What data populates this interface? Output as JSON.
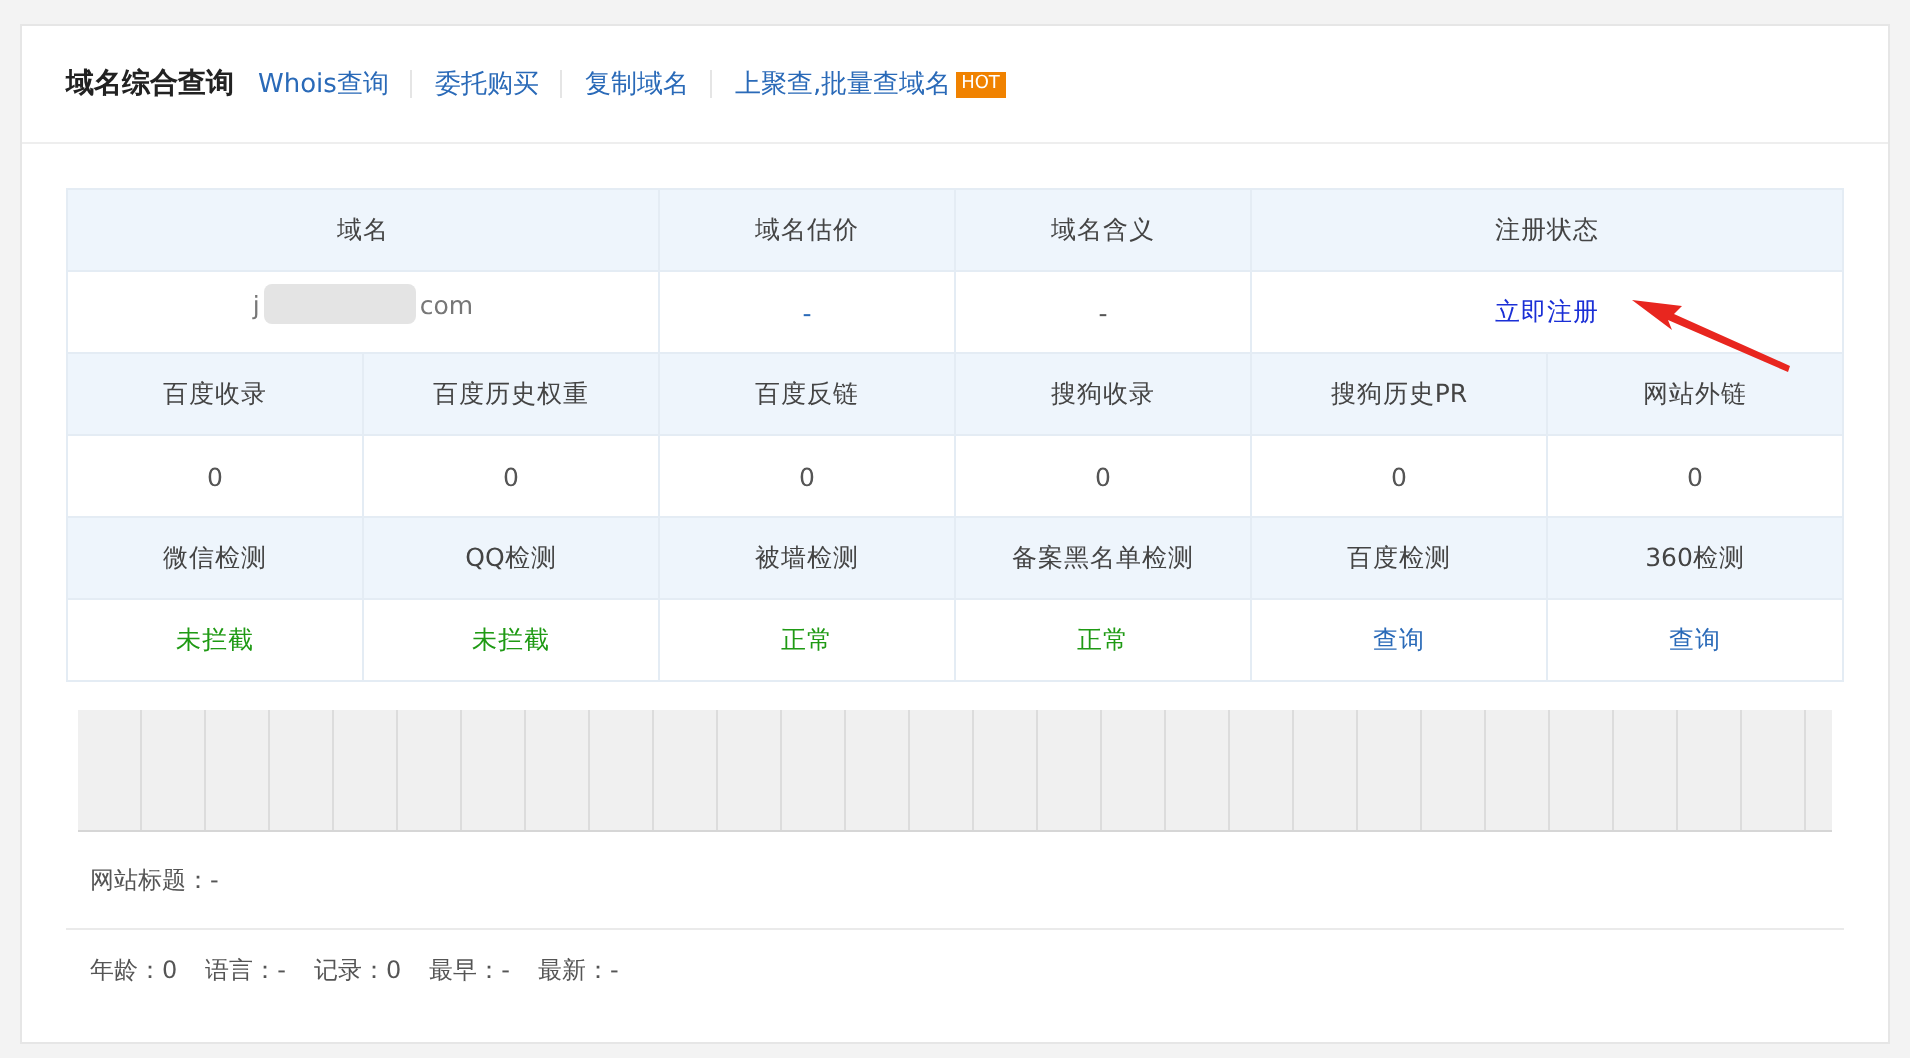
{
  "header": {
    "title": "域名综合查询",
    "links": [
      {
        "label": "Whois查询"
      },
      {
        "label": "委托购买"
      },
      {
        "label": "复制域名"
      },
      {
        "label": "上聚查,批量查域名",
        "badge": "HOT"
      }
    ]
  },
  "table": {
    "head": [
      "域名",
      "域名估价",
      "域名含义",
      "注册状态"
    ],
    "domain_row": {
      "domain_start": "j",
      "domain_end": "com",
      "valuation": "-",
      "meaning": "-",
      "status": "立即注册"
    },
    "metrics_head": [
      "百度收录",
      "百度历史权重",
      "百度反链",
      "搜狗收录",
      "搜狗历史PR",
      "网站外链"
    ],
    "metrics_values": [
      "0",
      "0",
      "0",
      "0",
      "0",
      "0"
    ],
    "checks_head": [
      "微信检测",
      "QQ检测",
      "被墙检测",
      "备案黑名单检测",
      "百度检测",
      "360检测"
    ],
    "checks_values": [
      {
        "text": "未拦截",
        "kind": "ok"
      },
      {
        "text": "未拦截",
        "kind": "ok"
      },
      {
        "text": "正常",
        "kind": "ok"
      },
      {
        "text": "正常",
        "kind": "ok"
      },
      {
        "text": "查询",
        "kind": "link"
      },
      {
        "text": "查询",
        "kind": "link"
      }
    ]
  },
  "site_title": "网站标题：-",
  "stats": [
    "年龄：0",
    "语言：-",
    "记录：0",
    "最早：-",
    "最新：-"
  ]
}
